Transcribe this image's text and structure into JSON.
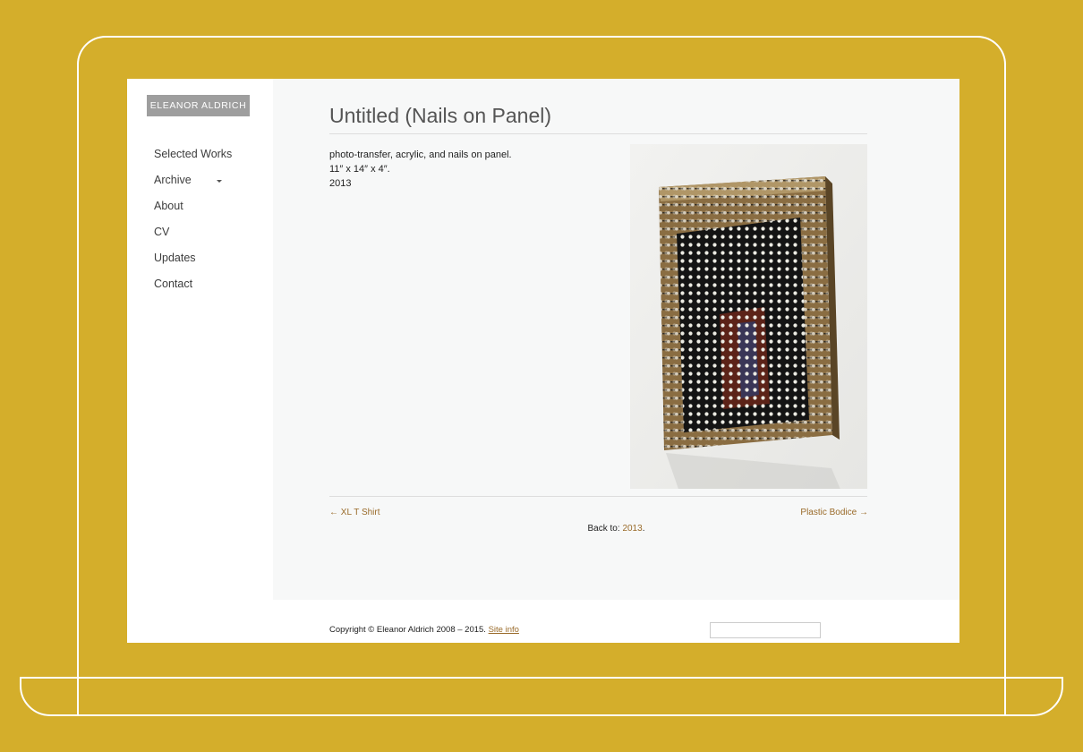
{
  "site": {
    "logo_text": "ELEANOR ALDRICH"
  },
  "nav": {
    "items": [
      {
        "label": "Selected Works"
      },
      {
        "label": "Archive",
        "has_dropdown": true
      },
      {
        "label": "About"
      },
      {
        "label": "CV"
      },
      {
        "label": "Updates"
      },
      {
        "label": "Contact"
      }
    ]
  },
  "artwork": {
    "title": "Untitled (Nails on Panel)",
    "medium": "photo-transfer, acrylic, and nails on panel.",
    "dimensions": "11″ x 14″ x 4″.",
    "year": "2013"
  },
  "pagination": {
    "prev": "← XL T Shirt",
    "next": "Plastic Bodice →",
    "back_label": "Back to:",
    "back_link": "2013",
    "back_suffix": "."
  },
  "footer": {
    "copyright": "Copyright © Eleanor Aldrich 2008 – 2015.",
    "site_info": "Site info",
    "search_placeholder": ""
  },
  "colors": {
    "background": "#d4ae2b",
    "link": "#9a6b2a",
    "logo_bg": "#9e9e9e",
    "content_bg": "#f7f8f8"
  }
}
